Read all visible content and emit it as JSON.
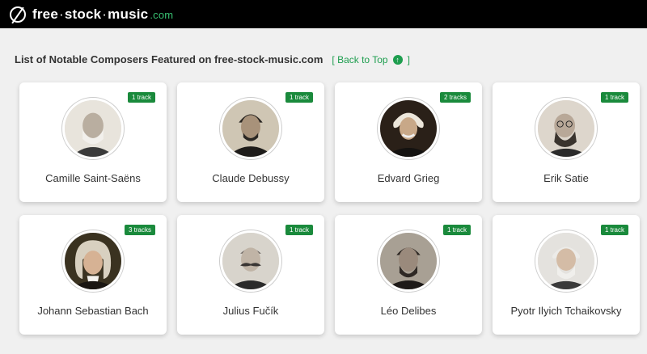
{
  "header": {
    "logo_parts": [
      "free",
      "stock",
      "music"
    ],
    "logo_separator": "·",
    "logo_tld": ".com"
  },
  "page": {
    "title": "List of Notable Composers Featured on free-stock-music.com",
    "back_open": "[ Back to Top",
    "back_close": "]"
  },
  "composers": [
    {
      "name": "Camille Saint-Saëns",
      "tracks": "1 track"
    },
    {
      "name": "Claude Debussy",
      "tracks": "1 track"
    },
    {
      "name": "Edvard Grieg",
      "tracks": "2 tracks"
    },
    {
      "name": "Erik Satie",
      "tracks": "1 track"
    },
    {
      "name": "Johann Sebastian Bach",
      "tracks": "3 tracks"
    },
    {
      "name": "Julius Fučík",
      "tracks": "1 track"
    },
    {
      "name": "Léo Delibes",
      "tracks": "1 track"
    },
    {
      "name": "Pyotr Ilyich Tchaikovsky",
      "tracks": "1 track"
    }
  ],
  "colors": {
    "accent": "#1a8a3c",
    "link": "#1e9e4f",
    "topbar": "#000000"
  }
}
